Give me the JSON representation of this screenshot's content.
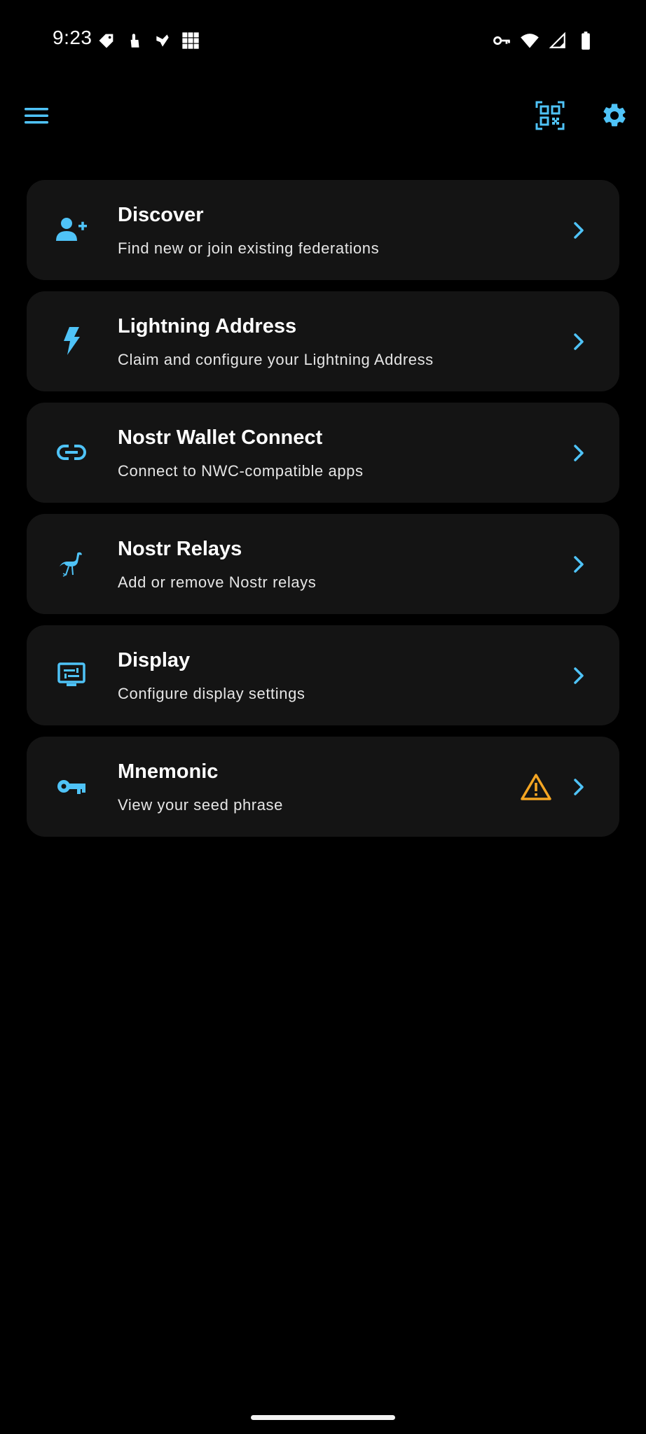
{
  "status_bar": {
    "time": "9:23",
    "left_icons": [
      "tag-icon",
      "touch-icon",
      "bird-icon",
      "grid-icon"
    ],
    "right_icons": [
      "vpn-key-icon",
      "wifi-icon",
      "signal-icon",
      "battery-icon"
    ]
  },
  "app_bar": {
    "icons": [
      "hamburger-menu-icon",
      "qr-scan-icon",
      "gear-icon"
    ]
  },
  "colors": {
    "background": "#000000",
    "card": "#141414",
    "accent": "#4fc3f7",
    "warning": "#f5a623",
    "title": "#ffffff",
    "subtitle": "#e6e6e6"
  },
  "menu": {
    "items": [
      {
        "title": "Discover",
        "subtitle": "Find new or join existing federations",
        "icon": "person-add-icon"
      },
      {
        "title": "Lightning Address",
        "subtitle": "Claim and configure your Lightning Address",
        "icon": "bolt-icon"
      },
      {
        "title": "Nostr Wallet Connect",
        "subtitle": "Connect to NWC-compatible apps",
        "icon": "link-icon"
      },
      {
        "title": "Nostr Relays",
        "subtitle": "Add or remove Nostr relays",
        "icon": "ostrich-icon"
      },
      {
        "title": "Display",
        "subtitle": "Configure display settings",
        "icon": "display-settings-icon"
      },
      {
        "title": "Mnemonic",
        "subtitle": "View your seed phrase",
        "icon": "key-icon",
        "warning_icon": "warning-icon"
      }
    ]
  }
}
